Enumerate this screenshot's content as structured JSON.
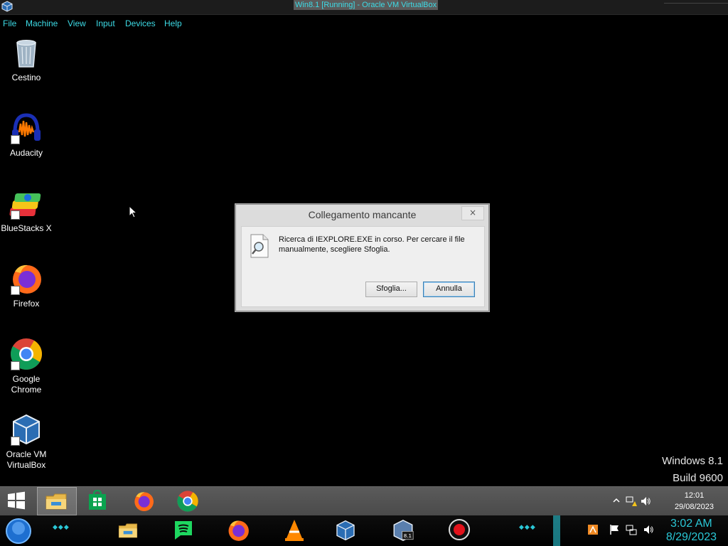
{
  "vbox": {
    "title": "Win8.1 [Running] - Oracle VM VirtualBox",
    "menu": [
      "File",
      "Machine",
      "View",
      "Input",
      "Devices",
      "Help"
    ]
  },
  "desktop": {
    "icons": [
      {
        "label": "Cestino",
        "icon": "recycle-bin-icon"
      },
      {
        "label": "Audacity",
        "icon": "audacity-icon"
      },
      {
        "label": "BlueStacks X",
        "icon": "bluestacks-icon"
      },
      {
        "label": "Firefox",
        "icon": "firefox-icon"
      },
      {
        "label": "Google Chrome",
        "icon": "chrome-icon"
      },
      {
        "label": "Oracle VM VirtualBox",
        "icon": "virtualbox-icon"
      }
    ],
    "watermark": {
      "line1": "Windows 8.1",
      "line2": "Build 9600"
    }
  },
  "dialog": {
    "title": "Collegamento mancante",
    "close_glyph": "×",
    "message": "Ricerca di IEXPLORE.EXE in corso. Per cercare il file manualmente, scegliere Sfoglia.",
    "buttons": {
      "browse": "Sfoglia...",
      "cancel": "Annulla"
    }
  },
  "guest_taskbar": {
    "pinned": [
      "start-icon",
      "file-explorer-icon",
      "store-icon",
      "firefox-icon",
      "chrome-icon"
    ],
    "clock": {
      "time": "12:01",
      "date": "29/08/2023"
    }
  },
  "host_dock": {
    "clock": {
      "time": "3:02 AM",
      "date": "8/29/2023"
    },
    "accent": "#2ac7d6"
  }
}
